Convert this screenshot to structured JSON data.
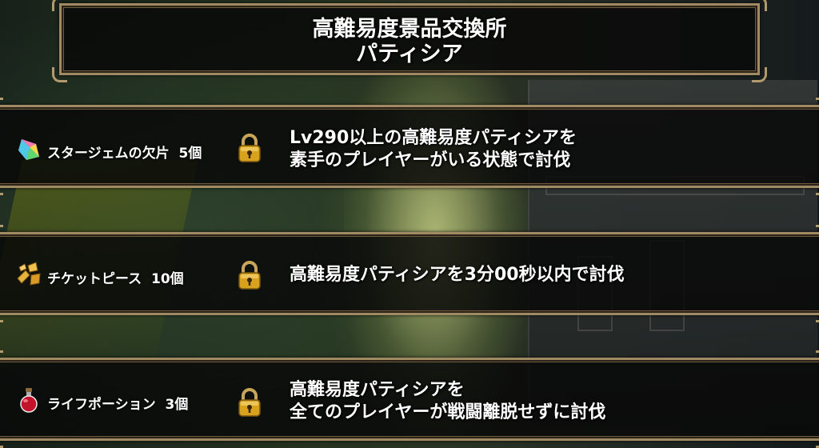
{
  "title": {
    "line1": "高難易度景品交換所",
    "line2": "パティシア"
  },
  "rewards": [
    {
      "item_name": "スタージェムの欠片",
      "quantity": "5個",
      "icon": "star-gem-fragment-icon",
      "locked": true,
      "condition": [
        "Lv290以上の高難易度パティシアを",
        "素手のプレイヤーがいる状態で討伐"
      ]
    },
    {
      "item_name": "チケットピース",
      "quantity": "10個",
      "icon": "ticket-piece-icon",
      "locked": true,
      "condition": [
        "高難易度パティシアを3分00秒以内で討伐"
      ]
    },
    {
      "item_name": "ライフポーション",
      "quantity": "3個",
      "icon": "life-potion-icon",
      "locked": true,
      "condition": [
        "高難易度パティシアを",
        "全てのプレイヤーが戦闘離脱せずに討伐"
      ]
    }
  ],
  "colors": {
    "frame_border": "#a08a63",
    "lock_gold": "#d8a21e",
    "panel_bg": "#080808"
  }
}
